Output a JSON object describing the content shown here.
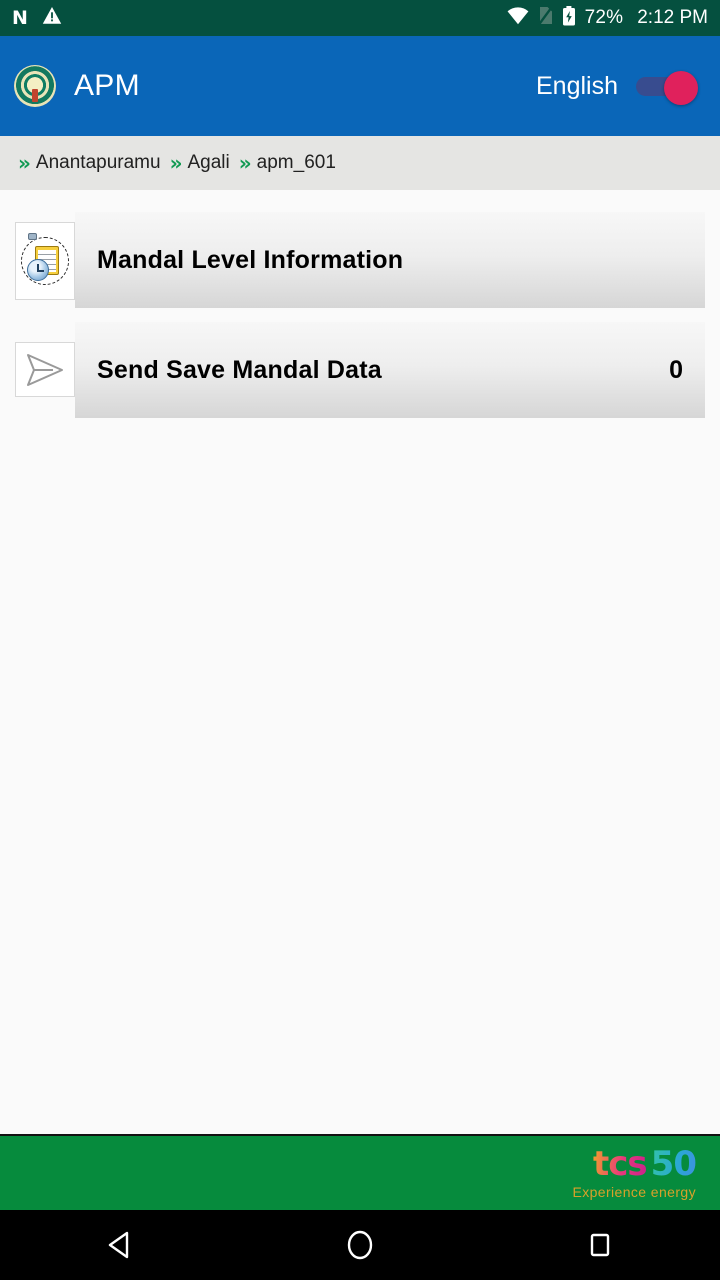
{
  "status_bar": {
    "left_icons": [
      {
        "name": "android-n-icon",
        "glyph": "N"
      },
      {
        "name": "warning-triangle-icon",
        "glyph": "!"
      }
    ],
    "wifi_icon": "wifi-icon",
    "sim_icon": "no-sim-icon",
    "battery_icon": "battery-charging-icon",
    "battery_percent": "72%",
    "time": "2:12 PM",
    "background_color": "#05503f"
  },
  "app_bar": {
    "logo_name": "ap-government-emblem",
    "title": "APM",
    "language_label": "English",
    "language_toggle_state": "on",
    "background_color": "#0a66b8",
    "toggle_thumb_color": "#e0215c",
    "toggle_track_color": "#3b4b8c"
  },
  "breadcrumb": {
    "separator": "»",
    "separator_color": "#119a53",
    "items": [
      {
        "label": "Anantapuramu"
      },
      {
        "label": "Agali"
      },
      {
        "label": "apm_601"
      }
    ]
  },
  "main": {
    "rows": [
      {
        "icon": "clipboard-clock-icon",
        "label": "Mandal Level Information",
        "count": ""
      },
      {
        "icon": "send-icon",
        "label": "Send Save Mandal Data",
        "count": "0"
      }
    ]
  },
  "footer": {
    "logo_mark": "tcs",
    "logo_number": "50",
    "tagline": "Experience energy",
    "background_color": "#068b3d"
  },
  "nav_bar": {
    "back": "back-button",
    "home": "home-button",
    "recents": "recents-button"
  }
}
